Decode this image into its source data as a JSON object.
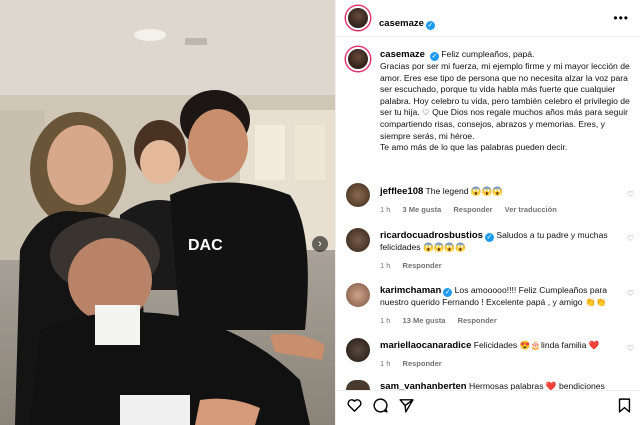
{
  "post": {
    "author": "casemaze",
    "caption_lines": [
      "Feliz cumpleaños, papá.",
      "Gracias por ser mi fuerza, mi ejemplo firme y mi mayor lección de amor. Eres ese tipo de persona que no necesita alzar la voz para ser escuchado, porque tu vida habla más fuerte que cualquier palabra. Hoy celebro tu vida, pero también celebro el privilegio de ser tu hija. ♡ Que Dios nos regale muchos años más para seguir compartiendo risas, consejos, abrazos y memorias. Eres, y siempre serás, mi héroe.",
      "Te amo más de lo que las palabras pueden decir."
    ],
    "more_label": "•••",
    "carousel_next": "›"
  },
  "comments": [
    {
      "user": "jefflee108",
      "verified": false,
      "text": "The legend 😱😱😱",
      "time": "1 h",
      "likes": "3 Me gusta",
      "reply": "Responder",
      "translate": "Ver traducción"
    },
    {
      "user": "ricardocuadrosbustios",
      "verified": true,
      "text": "Saludos a tu padre y muchas felicidades 😱😱😱😱",
      "time": "1 h",
      "likes": "",
      "reply": "Responder",
      "translate": ""
    },
    {
      "user": "karimchaman",
      "verified": true,
      "text": "Los amooooo!!!! Feliz Cumpleaños para nuestro querido Fernando ! Excelente papá , y amigo 👏👏",
      "time": "1 h",
      "likes": "13 Me gusta",
      "reply": "Responder",
      "translate": ""
    },
    {
      "user": "mariellaocanaradice",
      "verified": false,
      "text": "Felicidades 😍🎂linda familia ❤️",
      "time": "1 h",
      "likes": "",
      "reply": "Responder",
      "translate": ""
    },
    {
      "user": "sam_vanhanberten",
      "verified": false,
      "text": "Hermosas palabras ❤️ bendiciones",
      "time": "",
      "likes": "",
      "reply": "",
      "translate": ""
    }
  ],
  "action_icons": [
    "heart-icon",
    "comment-icon",
    "share-icon",
    "bookmark-icon"
  ],
  "colors": {
    "story_ring": "#e1306c",
    "verified": "#1d9bf0",
    "meta_text": "#737373",
    "divider": "#efefef"
  }
}
